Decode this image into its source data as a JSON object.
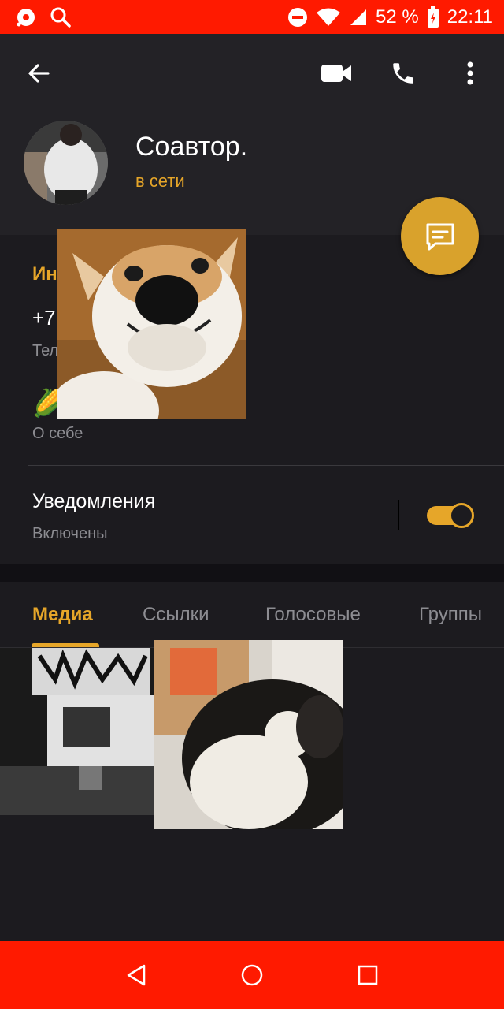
{
  "status_bar": {
    "battery": "52 %",
    "time": "22:11",
    "bg_color": "#ff1a00",
    "icons": [
      "record-icon",
      "search-icon",
      "dnd-icon",
      "wifi-icon",
      "signal-icon",
      "battery-icon"
    ]
  },
  "header": {
    "name": "Соавтор.",
    "status": "в сети",
    "accent": "#e6a629"
  },
  "info": {
    "title": "Ин",
    "phone": "+7",
    "phone_label": "Тел",
    "about_emoji": "🌽",
    "about_label": "О себе",
    "notifications_title": "Уведомления",
    "notifications_state": "Включены",
    "notifications_on": true
  },
  "tabs": [
    {
      "label": "Медиа",
      "active": true
    },
    {
      "label": "Ссылки",
      "active": false
    },
    {
      "label": "Голосовые",
      "active": false
    },
    {
      "label": "Группы",
      "active": false
    }
  ],
  "nav": {
    "icons": [
      "back-triangle-icon",
      "home-circle-icon",
      "recents-square-icon"
    ]
  }
}
